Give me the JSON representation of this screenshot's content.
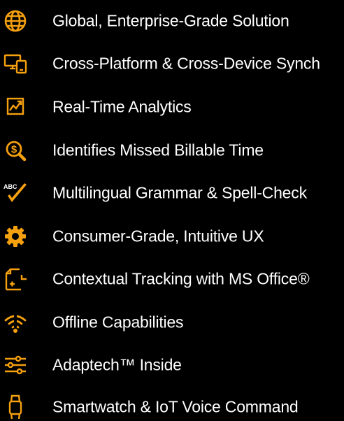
{
  "colors": {
    "background": "#000000",
    "accent": "#F5A00F",
    "text": "#FFFFFF"
  },
  "features": [
    {
      "icon": "globe-icon",
      "label": "Global, Enterprise-Grade Solution"
    },
    {
      "icon": "devices-icon",
      "label": "Cross-Platform & Cross-Device Synch"
    },
    {
      "icon": "analytics-chart-icon",
      "label": "Real-Time Analytics"
    },
    {
      "icon": "dollar-search-icon",
      "label": "Identifies Missed Billable Time"
    },
    {
      "icon": "abc-check-icon",
      "label": "Multilingual Grammar & Spell-Check"
    },
    {
      "icon": "gear-icon",
      "label": "Consumer-Grade, Intuitive UX"
    },
    {
      "icon": "document-plus-icon",
      "label": "Contextual Tracking with MS Office®"
    },
    {
      "icon": "wifi-off-icon",
      "label": "Offline Capabilities"
    },
    {
      "icon": "sliders-icon",
      "label": "Adaptech™ Inside"
    },
    {
      "icon": "smartwatch-icon",
      "label": "Smartwatch & IoT Voice Command"
    }
  ]
}
